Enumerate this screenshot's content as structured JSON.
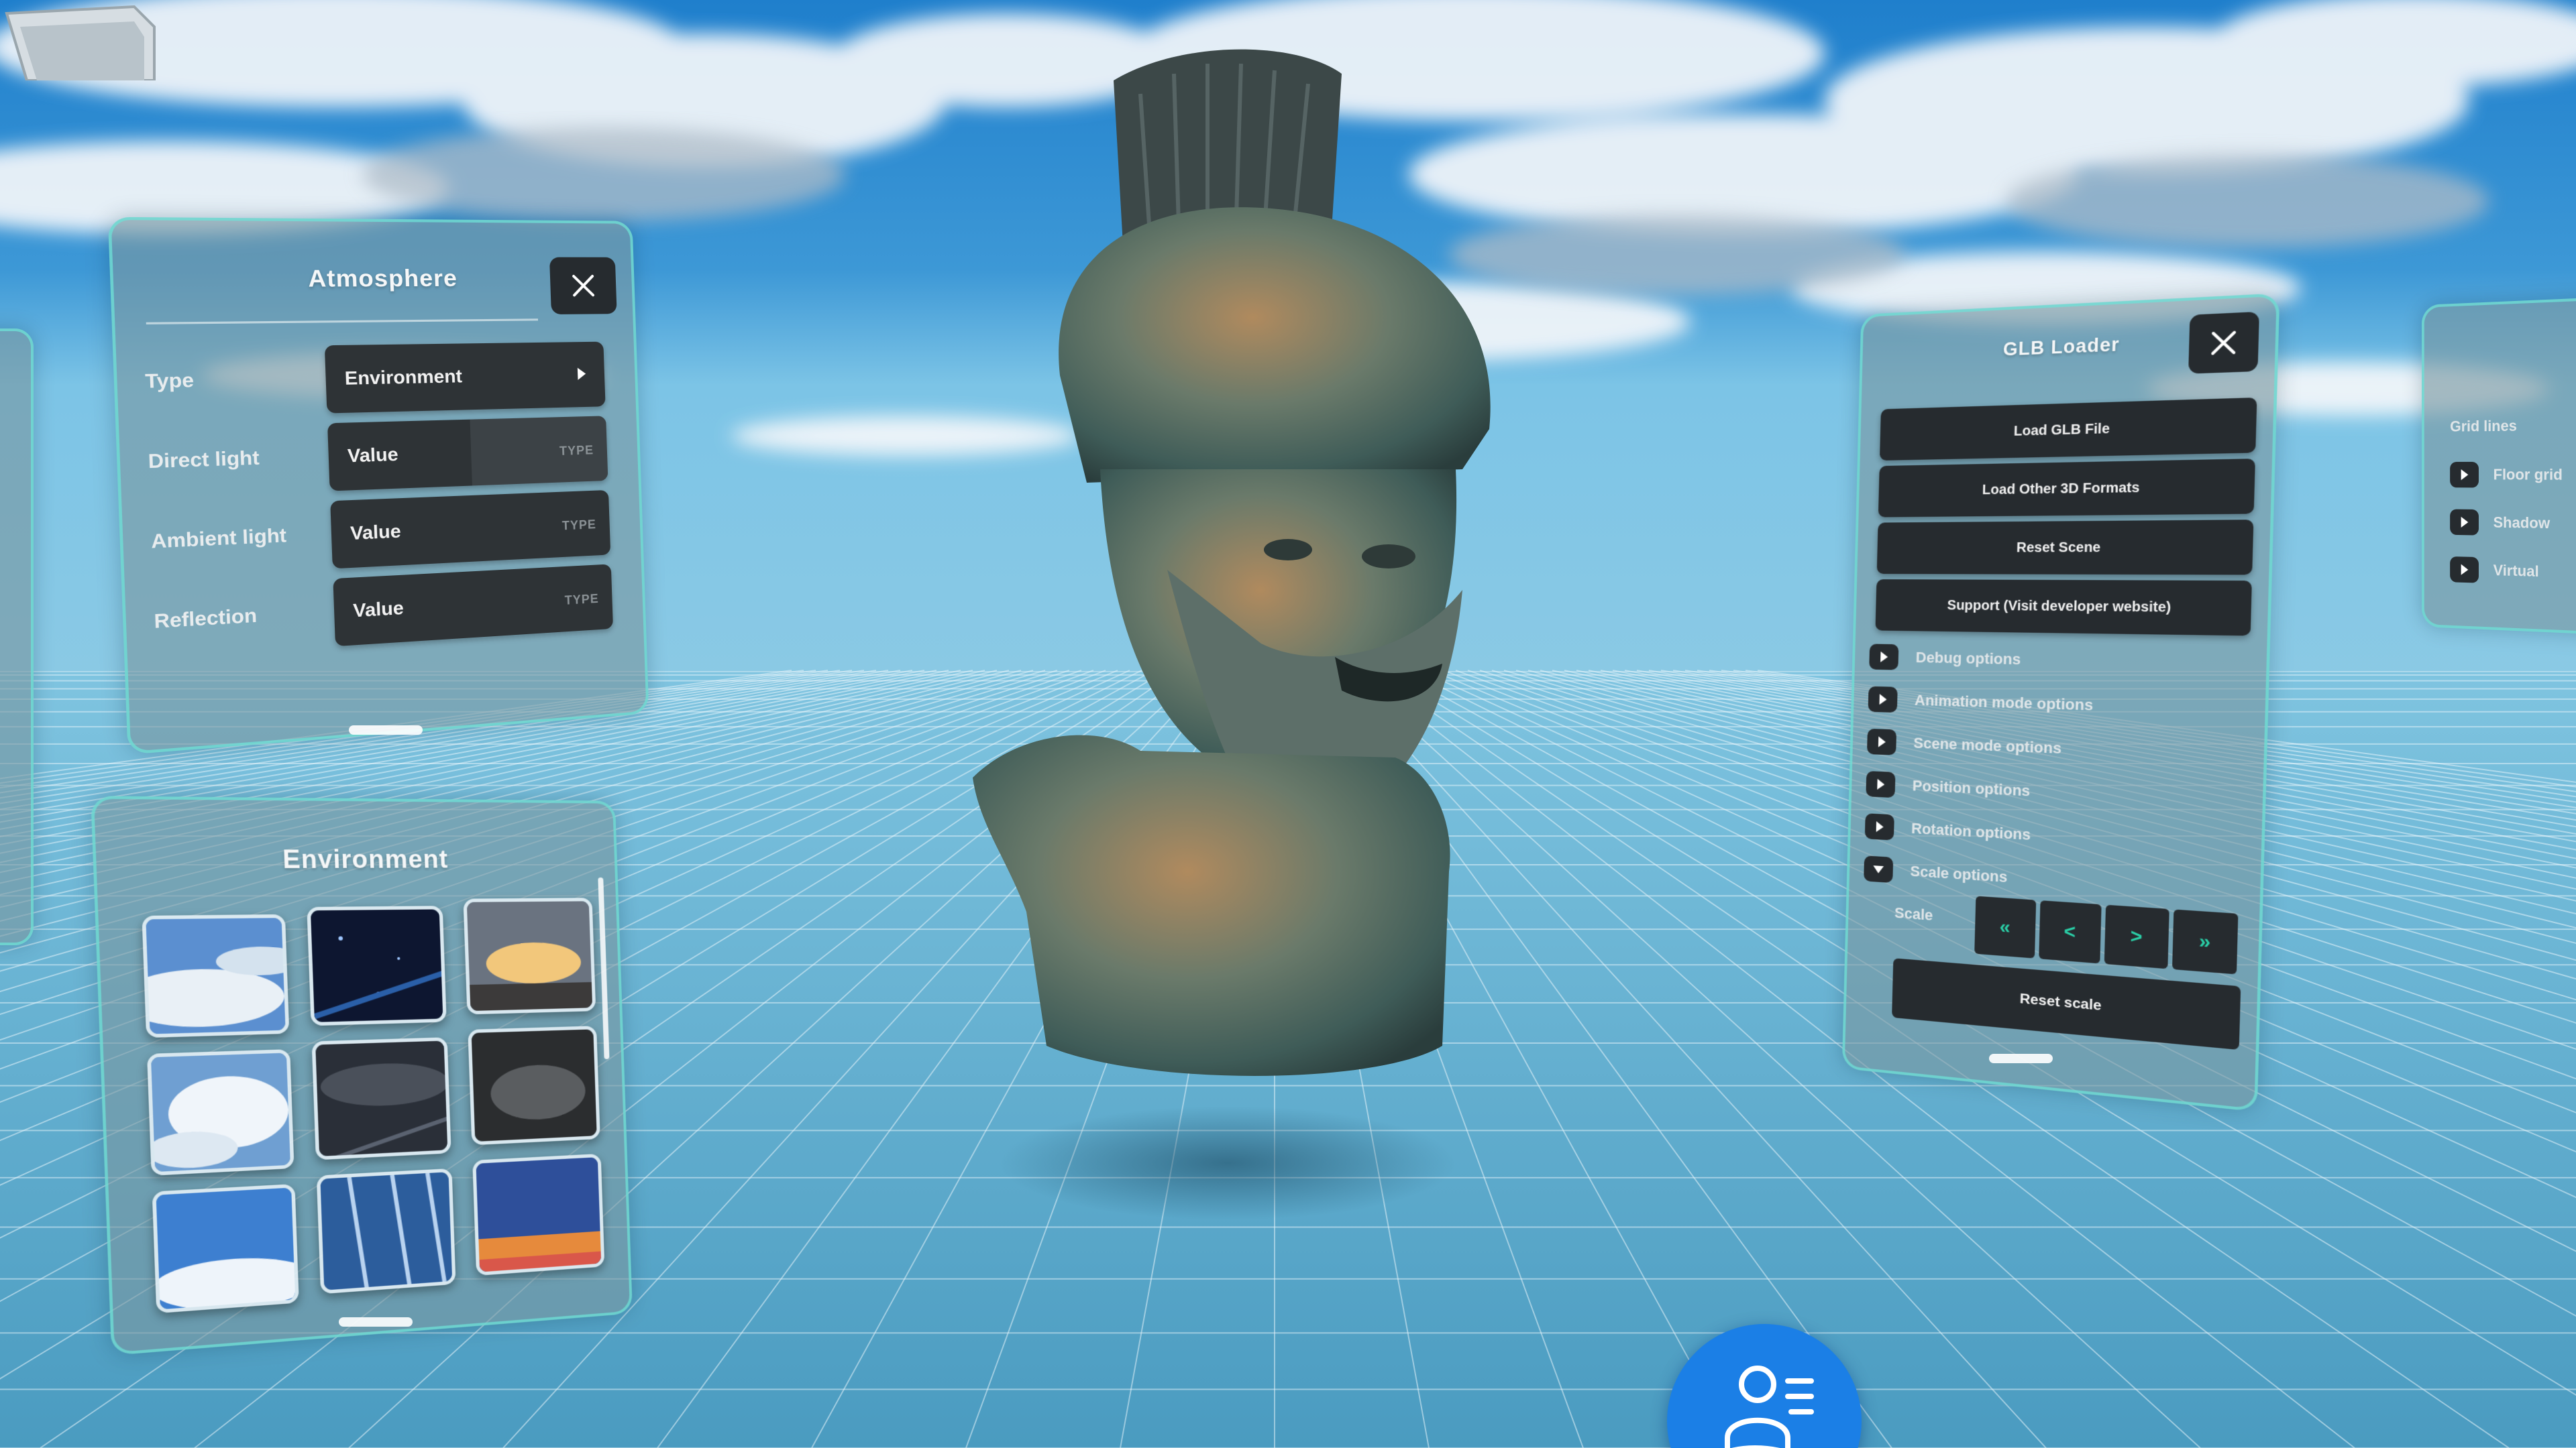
{
  "atmosphere": {
    "title": "Atmosphere",
    "rows": [
      {
        "label": "Type",
        "value": "Environment"
      },
      {
        "label": "Direct light",
        "value": "Value",
        "type": "TYPE"
      },
      {
        "label": "Ambient light",
        "value": "Value",
        "type": "TYPE"
      },
      {
        "label": "Reflection",
        "value": "Value",
        "type": "TYPE"
      }
    ]
  },
  "environment": {
    "title": "Environment",
    "thumbnails": [
      "sky-clouds-blue",
      "night-stars",
      "sunset-city",
      "cloud-burst",
      "dark-storm",
      "grey-smoke",
      "bright-sky",
      "rain-streaks",
      "dusk-horizon"
    ]
  },
  "glb_loader": {
    "title": "GLB Loader",
    "buttons": {
      "load_glb": "Load GLB File",
      "load_other": "Load Other 3D Formats",
      "reset_scene": "Reset Scene",
      "support": "Support (Visit developer website)"
    },
    "options": [
      {
        "label": "Debug options",
        "expanded": false
      },
      {
        "label": "Animation mode options",
        "expanded": false
      },
      {
        "label": "Scene mode options",
        "expanded": false
      },
      {
        "label": "Position options",
        "expanded": false
      },
      {
        "label": "Rotation options",
        "expanded": false
      },
      {
        "label": "Scale options",
        "expanded": true
      }
    ],
    "scale": {
      "label": "Scale",
      "steps": [
        "«",
        "<",
        ">",
        "»"
      ],
      "reset_label": "Reset scale"
    }
  },
  "far_right": {
    "heading": "Grid lines",
    "rows": [
      "Floor grid",
      "Shadow",
      "Virtual"
    ]
  },
  "colors": {
    "panel_border": "#6ee1d7",
    "button_dark": "#262b2f",
    "accent_green": "#2ad0a8",
    "user_button": "#1b7fe6"
  },
  "icons": {
    "close": "close-icon",
    "user_menu": "user-menu-icon"
  }
}
